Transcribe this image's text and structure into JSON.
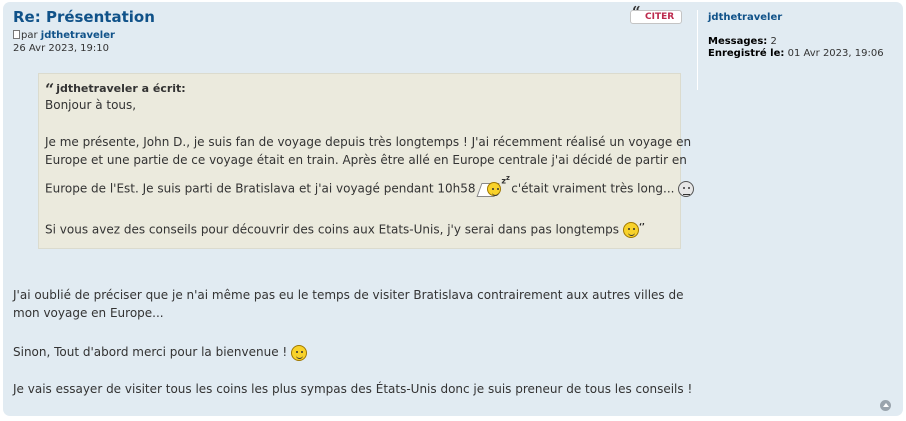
{
  "post": {
    "title": "Re: Présentation",
    "quote_button": "CITER",
    "author_prefix": "par",
    "author": "jdthetraveler",
    "date": "26 Avr 2023, 19:10"
  },
  "profile": {
    "username": "jdthetraveler",
    "messages_label": "Messages:",
    "messages_value": "2",
    "registered_label": "Enregistré le:",
    "registered_value": "01 Avr 2023, 19:06"
  },
  "quote": {
    "cite": "jdthetraveler a écrit:",
    "lines": [
      "Bonjour à tous,",
      "Je me présente, John D., je suis fan de voyage depuis très longtemps ! J'ai récemment réalisé un voyage en",
      "Europe et une partie de ce voyage était en train. Après être allé en Europe centrale j'ai décidé de partir en",
      "Europe de l'Est. Je suis parti de Bratislava et j'ai voyagé pendant 10h58",
      "c'était vraiment très long...",
      "Si vous avez des conseils pour découvrir des coins aux Etats-Unis, j'y serai dans pas longtemps"
    ]
  },
  "body": {
    "lines": [
      "J'ai oublié de préciser que je n'ai même pas eu le temps de visiter Bratislava contrairement aux autres villes de",
      "mon voyage en Europe...",
      "Sinon, Tout d'abord merci pour la bienvenue !",
      "Je vais essayer de visiter tous les coins les plus sympas des États-Unis donc je suis preneur de tous les conseils !"
    ]
  },
  "icons": {
    "sleep": "sleeping-smiley-icon",
    "neutral": "neutral-smiley-icon",
    "thinking": "thinking-smiley-icon",
    "wave": "waving-smiley-icon",
    "top": "back-to-top-icon"
  },
  "colors": {
    "post_bg": "#e1ebf2",
    "link": "#105289",
    "quote_bg": "#ebeadd",
    "quote_button_text": "#bc2a4d"
  }
}
